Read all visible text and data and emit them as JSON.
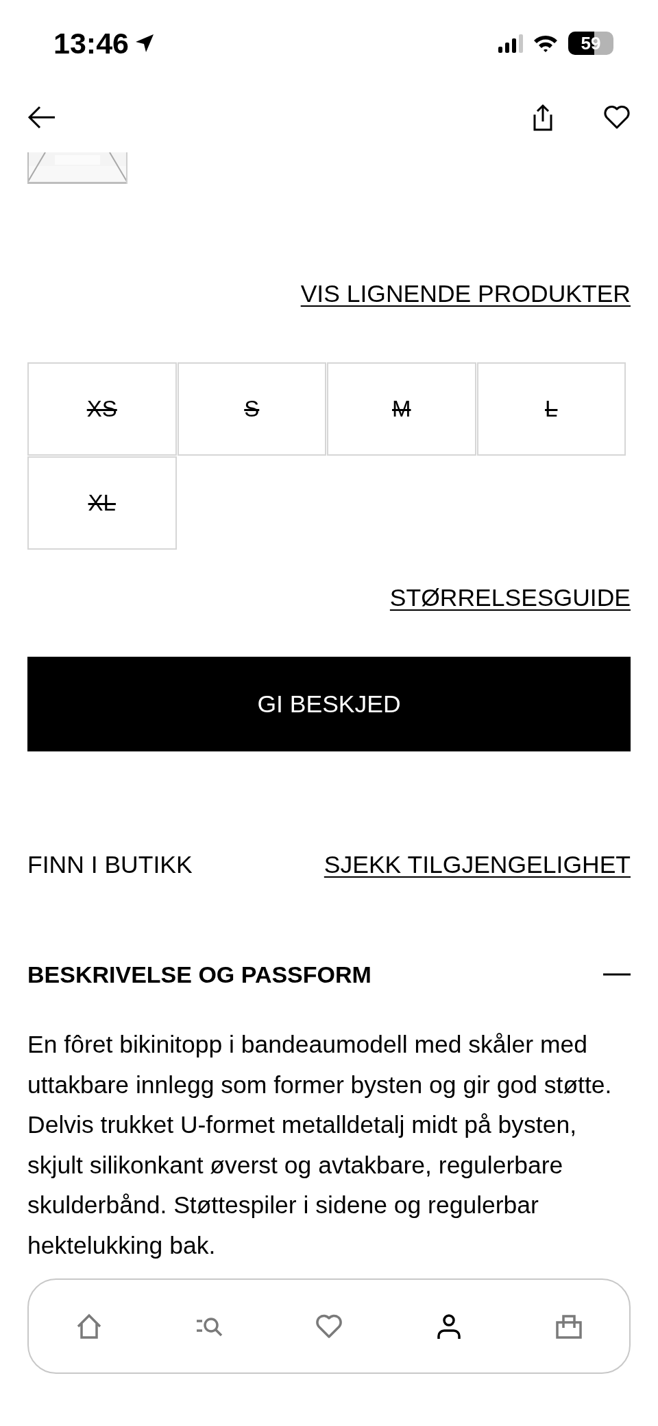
{
  "status_bar": {
    "time": "13:46",
    "battery": "59"
  },
  "similar_link": "VIS LIGNENDE PRODUKTER",
  "sizes": [
    {
      "label": "XS",
      "available": false
    },
    {
      "label": "S",
      "available": false
    },
    {
      "label": "M",
      "available": false
    },
    {
      "label": "L",
      "available": false
    },
    {
      "label": "XL",
      "available": false
    }
  ],
  "size_guide_link": "STØRRELSESGUIDE",
  "notify_button": "GI BESKJED",
  "store": {
    "label": "FINN I BUTIKK",
    "link": "SJEKK TILGJENGELIGHET"
  },
  "description": {
    "title": "BESKRIVELSE OG PASSFORM",
    "expanded": true,
    "text": "En fôret bikinitopp i bandeaumodell med skåler med uttakbare innlegg som former bysten og gir god støtte. Delvis trukket U-formet metalldetalj midt på bysten, skjult silikonkant øverst og avtakbare, regulerbare skulderbånd. Støttespiler i sidene og regulerbar hektelukking bak."
  },
  "tab_bar": [
    {
      "kind": "home",
      "selected": false
    },
    {
      "kind": "search",
      "selected": false
    },
    {
      "kind": "favorites",
      "selected": false
    },
    {
      "kind": "account",
      "selected": true
    },
    {
      "kind": "bag",
      "selected": false
    }
  ]
}
